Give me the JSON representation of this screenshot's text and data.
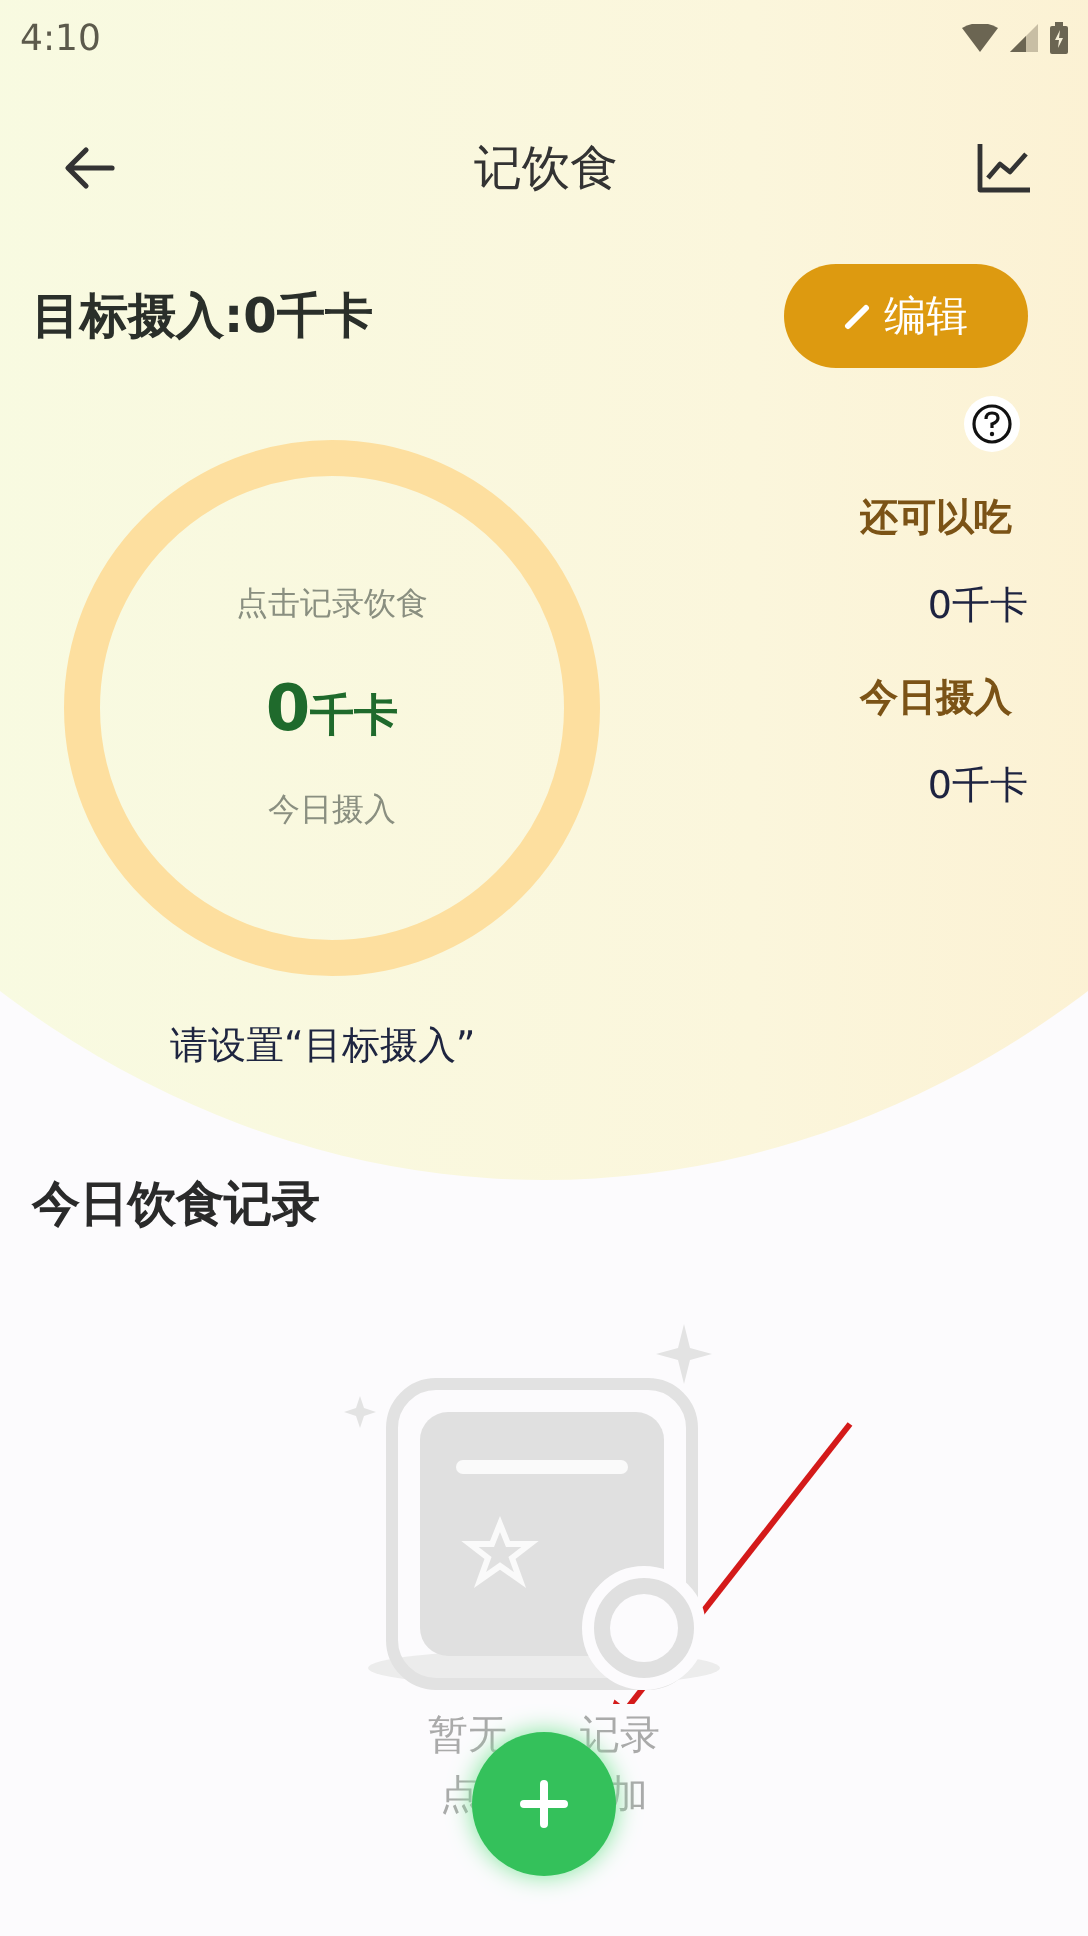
{
  "status_bar": {
    "time": "4:10"
  },
  "header": {
    "title": "记饮食"
  },
  "target": {
    "label": "目标摄入:0千卡",
    "edit_button": "编辑"
  },
  "ring": {
    "hint": "点击记录饮食",
    "value": "0",
    "unit": "千卡",
    "caption": "今日摄入"
  },
  "stats": [
    {
      "label": "还可以吃",
      "value": "0千卡"
    },
    {
      "label": "今日摄入",
      "value": "0千卡"
    }
  ],
  "notice": "请设置“目标摄入”",
  "records": {
    "title": "今日饮食记录",
    "empty_lines": [
      [
        "暂无",
        "记录"
      ],
      [
        "点",
        "加"
      ]
    ]
  }
}
